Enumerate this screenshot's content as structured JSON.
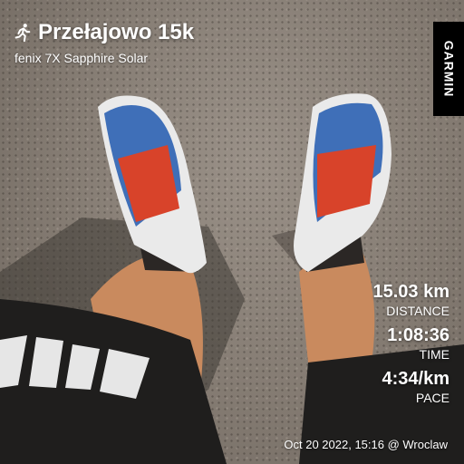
{
  "activity": {
    "title": "Przełajowo 15k",
    "device": "fenix 7X Sapphire Solar",
    "brand": "GARMIN",
    "icon": "running-person-icon"
  },
  "stats": [
    {
      "value": "15.03 km",
      "label": "DISTANCE"
    },
    {
      "value": "1:08:36",
      "label": "TIME"
    },
    {
      "value": "4:34/km",
      "label": "PACE"
    }
  ],
  "footer": "Oct 20 2022, 15:16 @ Wroclaw",
  "colors": {
    "text": "#ffffff",
    "brand_bg": "#000000",
    "shoe_blue": "#3f6fb8",
    "lace_red": "#d8432a"
  }
}
